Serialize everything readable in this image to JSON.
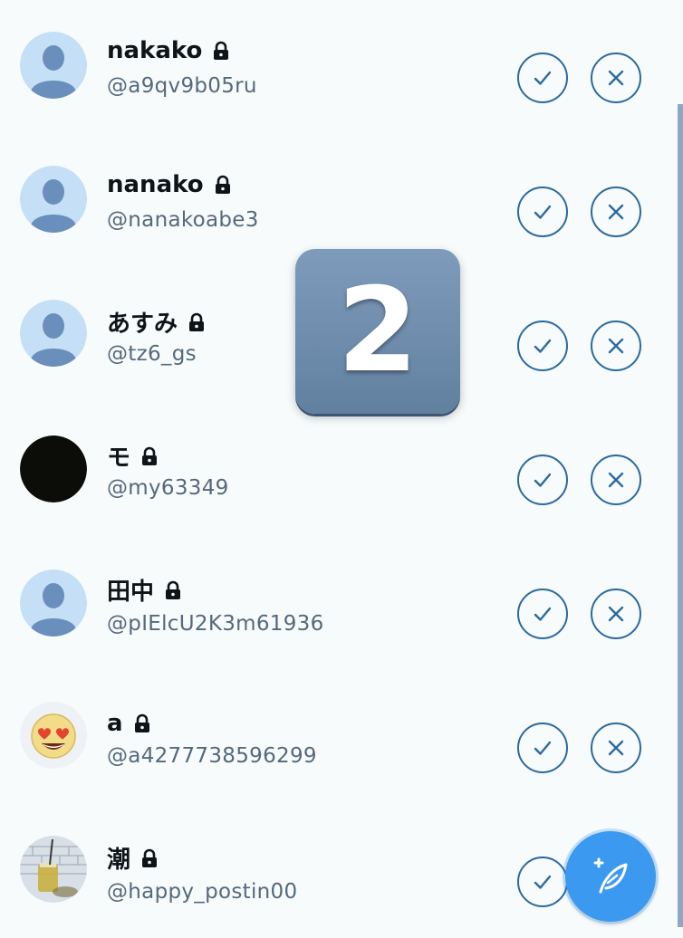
{
  "requests": [
    {
      "name": "nakako",
      "handle": "@a9qv9b05ru",
      "avatar": "default-avatar-icon"
    },
    {
      "name": "nanako",
      "handle": "@nanakoabe3",
      "avatar": "default-avatar-icon"
    },
    {
      "name": "あすみ",
      "handle": "@tz6_gs",
      "avatar": "default-avatar-icon"
    },
    {
      "name": "モ",
      "handle": "@my63349",
      "avatar": "black-circle-avatar"
    },
    {
      "name": "田中",
      "handle": "@pIElcU2K3m61936",
      "avatar": "default-avatar-icon"
    },
    {
      "name": "a",
      "handle": "@a4277738596299",
      "avatar": "heart-eyes-emoji-avatar"
    },
    {
      "name": "潮",
      "handle": "@happy_postin00",
      "avatar": "photo-avatar"
    }
  ],
  "overlay": {
    "number": "2"
  },
  "icons": {
    "accept": "check-icon",
    "reject": "close-icon",
    "locked": "lock-icon",
    "compose": "compose-feather-icon"
  },
  "colors": {
    "background": "#f7fbfc",
    "accent": "#2b6aa0",
    "fab": "#3b9af0",
    "avatar_bg": "#c4dff6",
    "avatar_fg": "#6a8fbd"
  }
}
